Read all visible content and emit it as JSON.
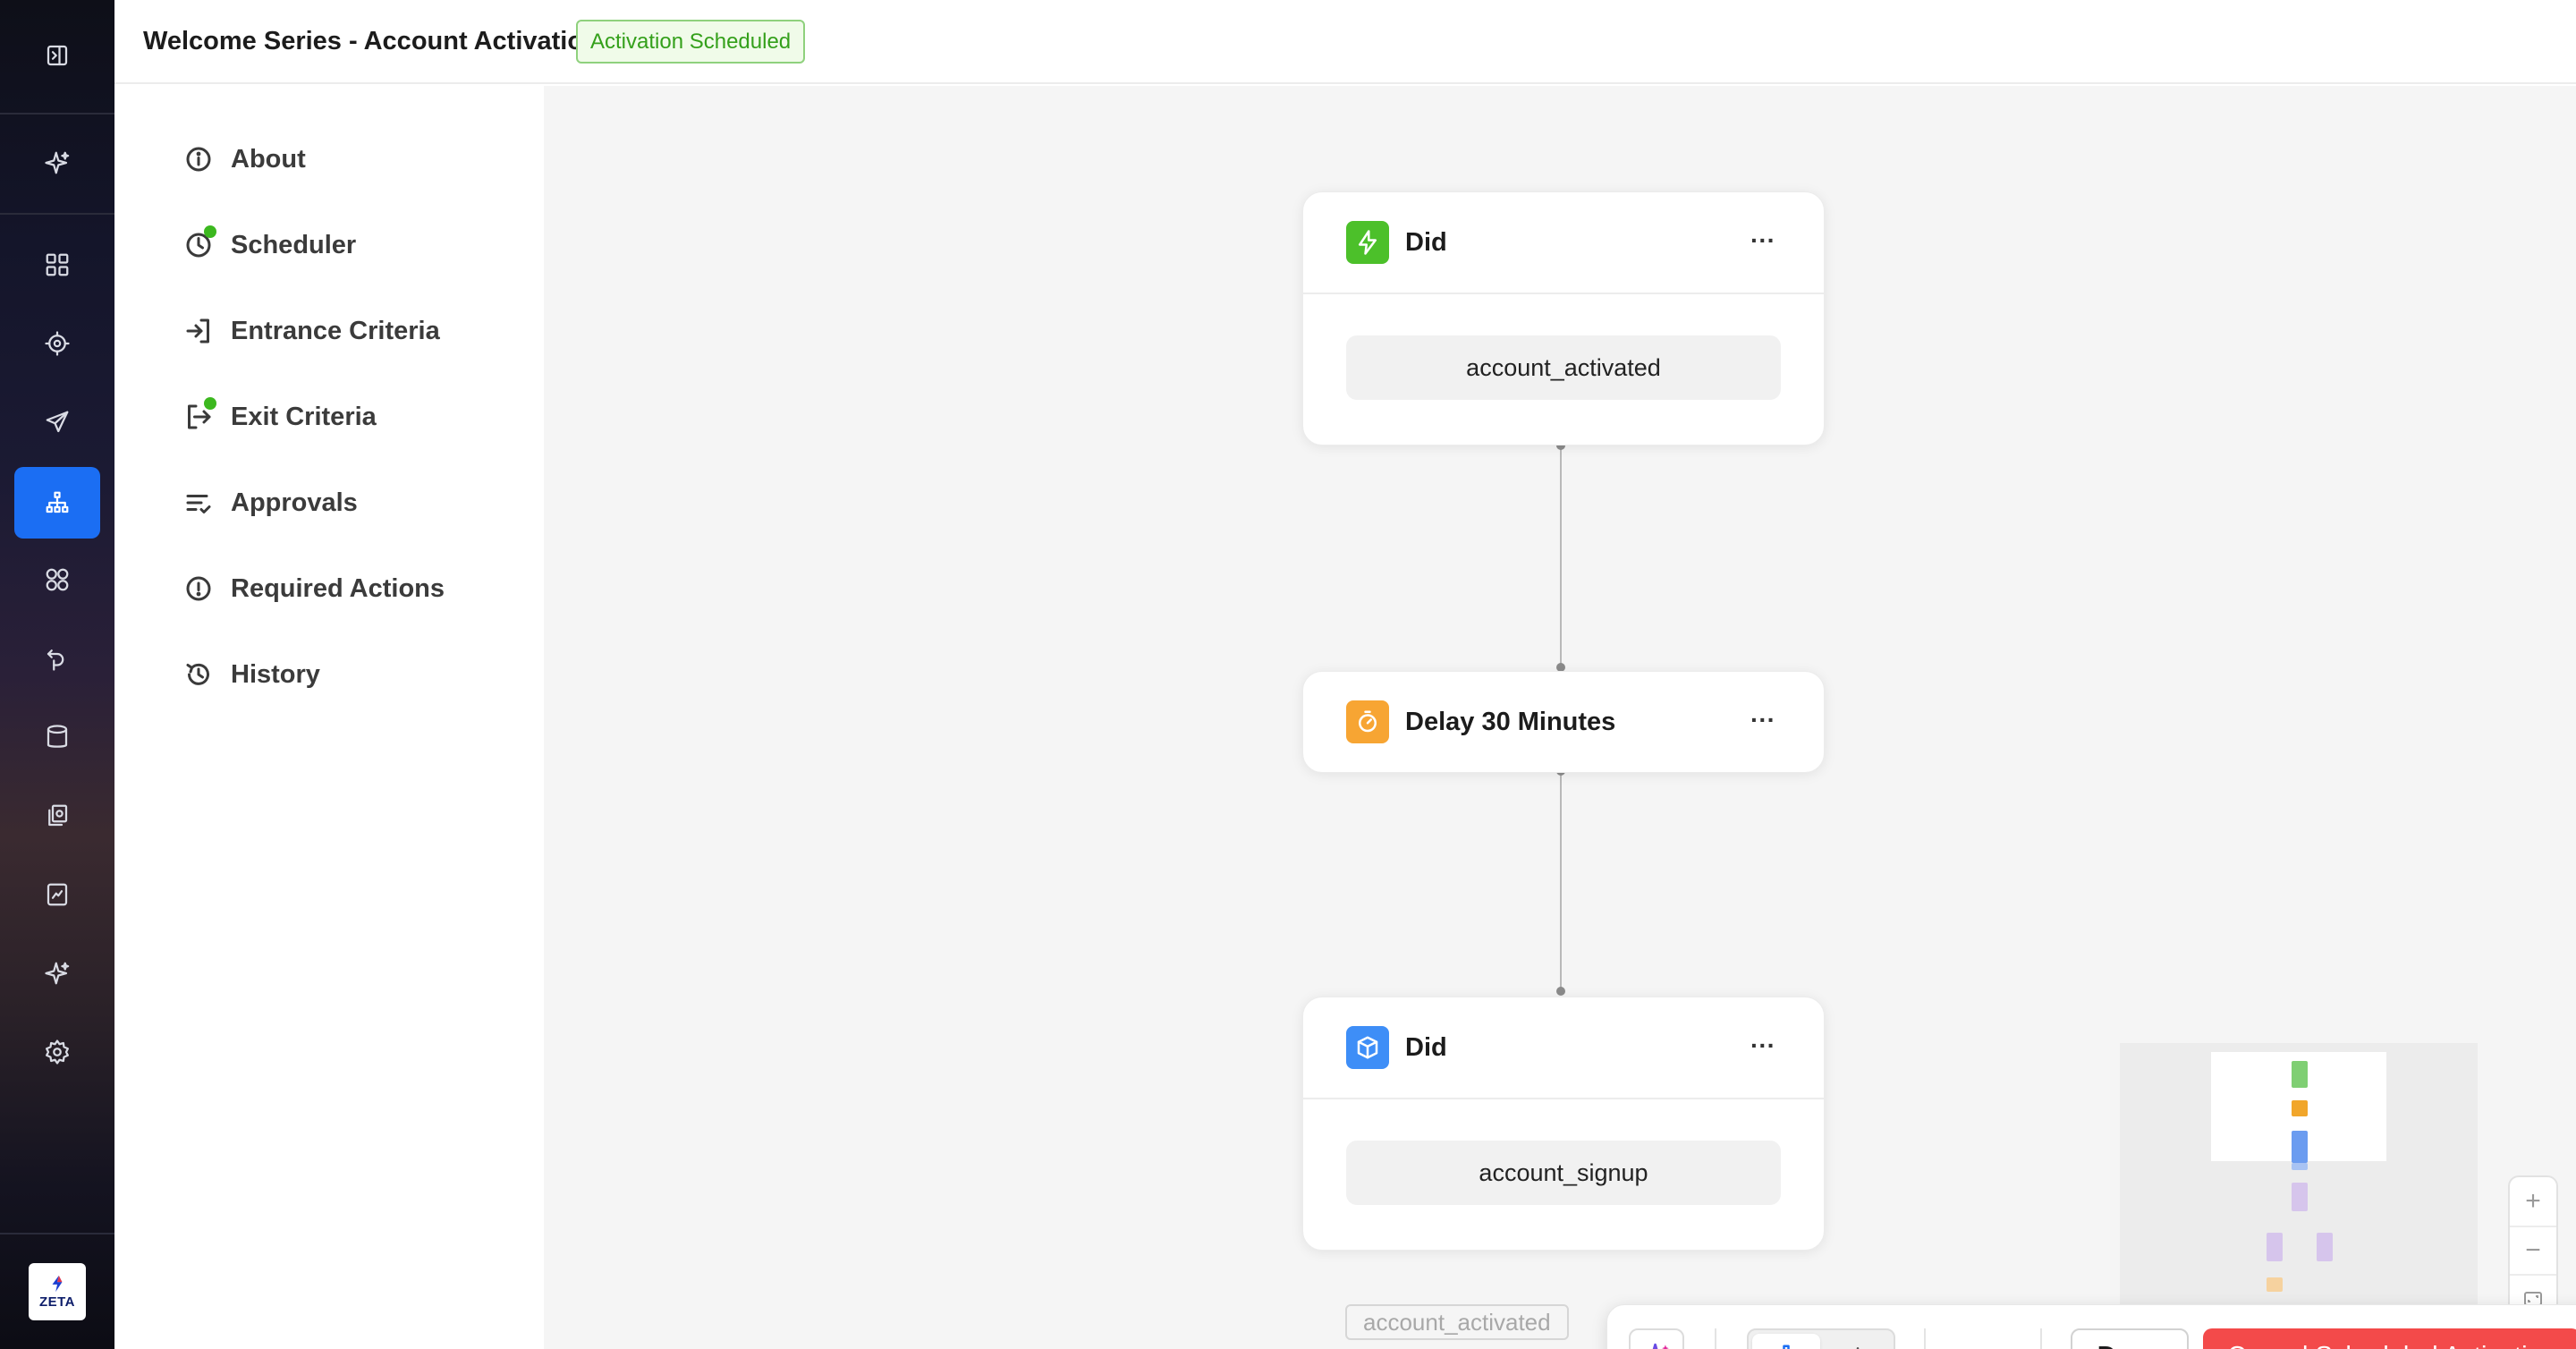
{
  "header": {
    "title": "Welcome Series - Account Activation",
    "status_badge": "Activation Scheduled"
  },
  "rail": {
    "items": [
      {
        "icon": "panel-toggle-icon"
      },
      {
        "icon": "sparkle-icon"
      },
      {
        "icon": "dashboard-grid-icon"
      },
      {
        "icon": "target-icon"
      },
      {
        "icon": "send-icon"
      },
      {
        "icon": "hierarchy-icon",
        "active": true
      },
      {
        "icon": "components-icon"
      },
      {
        "icon": "journey-icon"
      },
      {
        "icon": "database-icon"
      },
      {
        "icon": "library-icon"
      },
      {
        "icon": "report-icon"
      },
      {
        "icon": "sparkle-icon"
      },
      {
        "icon": "gear-icon"
      }
    ],
    "logo_text": "ZETA"
  },
  "menu": {
    "items": [
      {
        "label": "About",
        "icon": "info-icon",
        "indicator": false
      },
      {
        "label": "Scheduler",
        "icon": "clock-icon",
        "indicator": true
      },
      {
        "label": "Entrance Criteria",
        "icon": "enter-icon",
        "indicator": false
      },
      {
        "label": "Exit Criteria",
        "icon": "exit-icon",
        "indicator": true
      },
      {
        "label": "Approvals",
        "icon": "approvals-icon",
        "indicator": false
      },
      {
        "label": "Required Actions",
        "icon": "alert-icon",
        "indicator": false
      },
      {
        "label": "History",
        "icon": "history-icon",
        "indicator": false
      }
    ]
  },
  "canvas": {
    "nodes": [
      {
        "title": "Did",
        "icon": "lightning-icon",
        "icon_color": "#4cc02a",
        "event": "account_activated"
      },
      {
        "title": "Delay 30 Minutes",
        "icon": "timer-icon",
        "icon_color": "#f7a533"
      },
      {
        "title": "Did",
        "icon": "box-icon",
        "icon_color": "#3e8ef7",
        "event": "account_signup"
      }
    ],
    "partial_label": "account_activated"
  },
  "toolbar": {
    "done_label": "Done",
    "cancel_label": "Cancel Scheduled Activation",
    "more_label": "···"
  },
  "colors": {
    "accent": "#1b6ef3",
    "danger": "#f34a4a",
    "success": "#3cb81f"
  }
}
